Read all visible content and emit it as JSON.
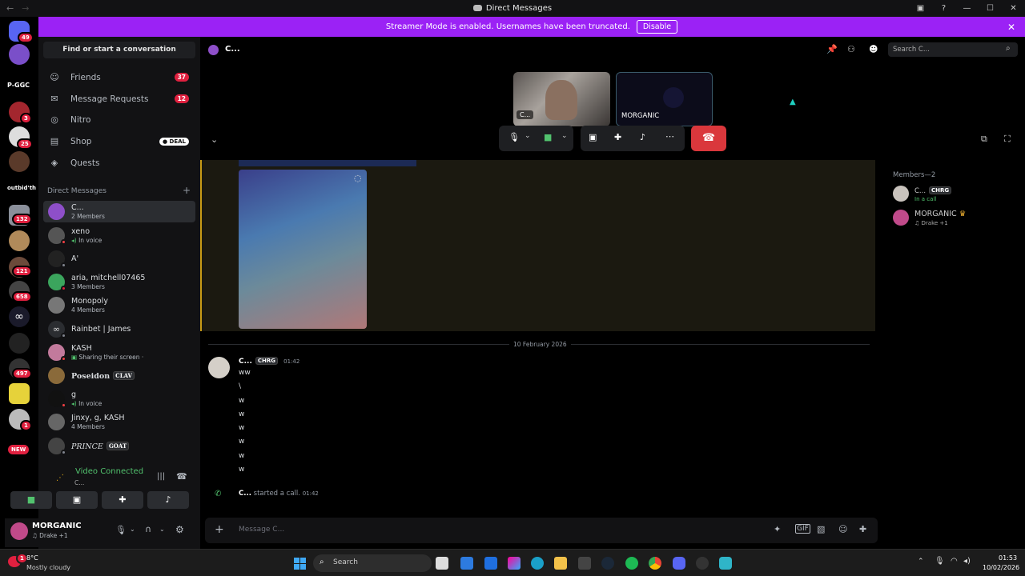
{
  "window": {
    "title": "Direct Messages"
  },
  "banner": {
    "text": "Streamer Mode is enabled. Usernames have been truncated.",
    "button": "Disable"
  },
  "guild_badges": {
    "home": "49",
    "g4": "3",
    "g5": "25",
    "g8": "132",
    "g10": "121",
    "g11": "658",
    "g13": "497",
    "g15": "1",
    "new": "NEW",
    "text_label1": "P-GGC",
    "text_label2": "outbid'th"
  },
  "sidebar": {
    "find": "Find or start a conversation",
    "nav": [
      {
        "label": "Friends",
        "count": "37"
      },
      {
        "label": "Message Requests",
        "count": "12"
      },
      {
        "label": "Nitro"
      },
      {
        "label": "Shop",
        "badge": "DEAL"
      },
      {
        "label": "Quests"
      }
    ],
    "dm_header": "Direct Messages",
    "dms": [
      {
        "name": "C...",
        "sub": "2 Members"
      },
      {
        "name": "xeno",
        "sub": "In voice"
      },
      {
        "name": "A'",
        "sub": ""
      },
      {
        "name": "aria, mitchell07465",
        "sub": "3 Members"
      },
      {
        "name": "Monopoly",
        "sub": "4 Members"
      },
      {
        "name": "Rainbet | James",
        "sub": ""
      },
      {
        "name": "KASH",
        "sub": "Sharing their screen ·"
      },
      {
        "name": "Poseidon",
        "tag": "CLAV",
        "sub": ""
      },
      {
        "name": "g",
        "sub": "In voice"
      },
      {
        "name": "Jinxy, g, KASH",
        "sub": "4 Members"
      },
      {
        "name": "PRINCE",
        "tag": "GOAT",
        "sub": ""
      }
    ]
  },
  "voice": {
    "status": "Video Connected",
    "channel": "C..."
  },
  "user": {
    "name": "MORGANIC",
    "activity": "Drake +1"
  },
  "channel": {
    "name": "C...",
    "search_placeholder": "Search C..."
  },
  "call": {
    "tile1_label": "C...",
    "tile2_label": "MORGANIC"
  },
  "members": {
    "header": "Members—2",
    "list": [
      {
        "name": "C...",
        "tag": "CHRG",
        "sub": "In a call"
      },
      {
        "name": "MORGANIC",
        "sub": "Drake +1"
      }
    ]
  },
  "chat": {
    "date_divider": "10 February 2026",
    "author": "C...",
    "author_tag": "CHRG",
    "time": "01:42",
    "lines": [
      "ww",
      "\\",
      "w",
      "w",
      "w",
      "w",
      "w",
      "w"
    ],
    "system_author": "C...",
    "system_text": "started a call.",
    "system_time": "01:42",
    "composer_placeholder": "Message C..."
  },
  "taskbar": {
    "temp": "8°C",
    "weather": "Mostly cloudy",
    "search": "Search",
    "time": "01:53",
    "date": "10/02/2026",
    "weather_badge": "1"
  },
  "colors": {
    "accent": "#9b22f5",
    "voice_green": "#52c26e",
    "danger": "#da373c"
  }
}
